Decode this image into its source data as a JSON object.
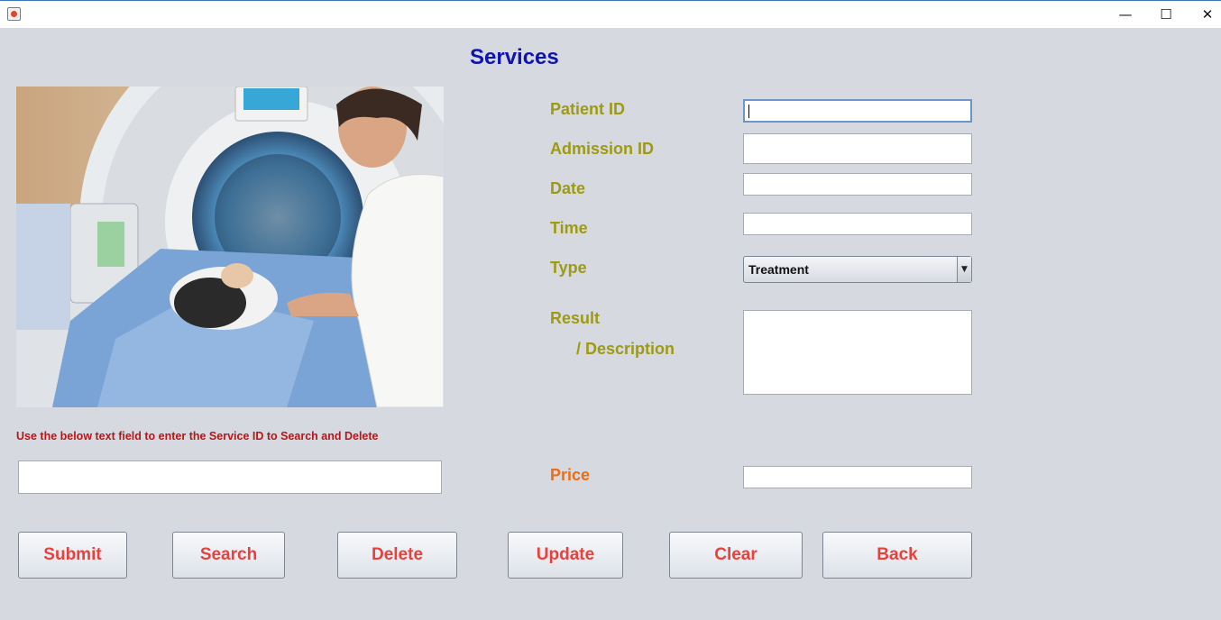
{
  "window": {
    "minimize_glyph": "—",
    "maximize_glyph": "☐",
    "close_glyph": "✕"
  },
  "page_title": "Services",
  "image": {
    "subject": "patient in CT scanner with technician"
  },
  "form": {
    "patient_id_label": "Patient ID",
    "patient_id_value": "",
    "admission_id_label": "Admission ID",
    "admission_id_value": "",
    "date_label": "Date",
    "date_value": "",
    "time_label": "Time",
    "time_value": "",
    "type_label": "Type",
    "type_value": "Treatment",
    "result_label": "Result",
    "description_label": "/ Description",
    "result_value": "",
    "price_label": "Price",
    "price_value": ""
  },
  "search": {
    "hint": "Use the below text field to  enter the Service ID  to Search and Delete",
    "service_id_value": ""
  },
  "buttons": {
    "submit": "Submit",
    "search": "Search",
    "delete": "Delete",
    "update": "Update",
    "clear": "Clear",
    "back": "Back"
  },
  "colors": {
    "title": "#0f13b0",
    "labels": "#9e9a12",
    "price_label": "#ee6d12",
    "hint": "#b81616",
    "button_text": "#e8413d",
    "background": "#d6d9e0"
  }
}
